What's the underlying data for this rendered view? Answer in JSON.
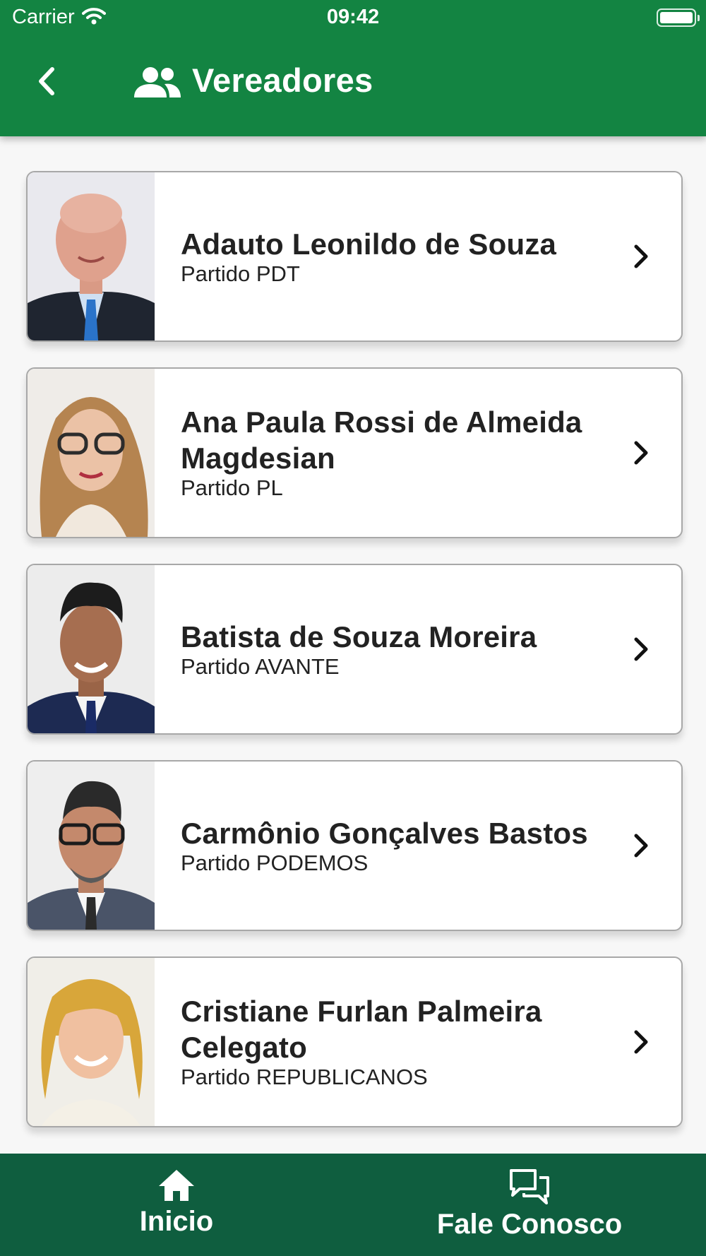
{
  "status_bar": {
    "carrier": "Carrier",
    "time": "09:42"
  },
  "header": {
    "title": "Vereadores",
    "icon": "people-icon",
    "back_icon": "chevron-left-icon",
    "color": "#138442"
  },
  "council_members": [
    {
      "name": "Adauto Leonildo de Souza",
      "party": "Partido PDT"
    },
    {
      "name": "Ana Paula Rossi de Almeida Magdesian",
      "party": "Partido PL"
    },
    {
      "name": "Batista de Souza Moreira",
      "party": "Partido AVANTE"
    },
    {
      "name": "Carmônio Gonçalves Bastos",
      "party": "Partido PODEMOS"
    },
    {
      "name": "Cristiane Furlan Palmeira Celegato",
      "party": "Partido REPUBLICANOS"
    }
  ],
  "tab_bar": {
    "color": "#0f5e3f",
    "tabs": [
      {
        "label": "Inicio",
        "icon": "home-icon"
      },
      {
        "label": "Fale Conosco",
        "icon": "chat-icon"
      }
    ]
  }
}
